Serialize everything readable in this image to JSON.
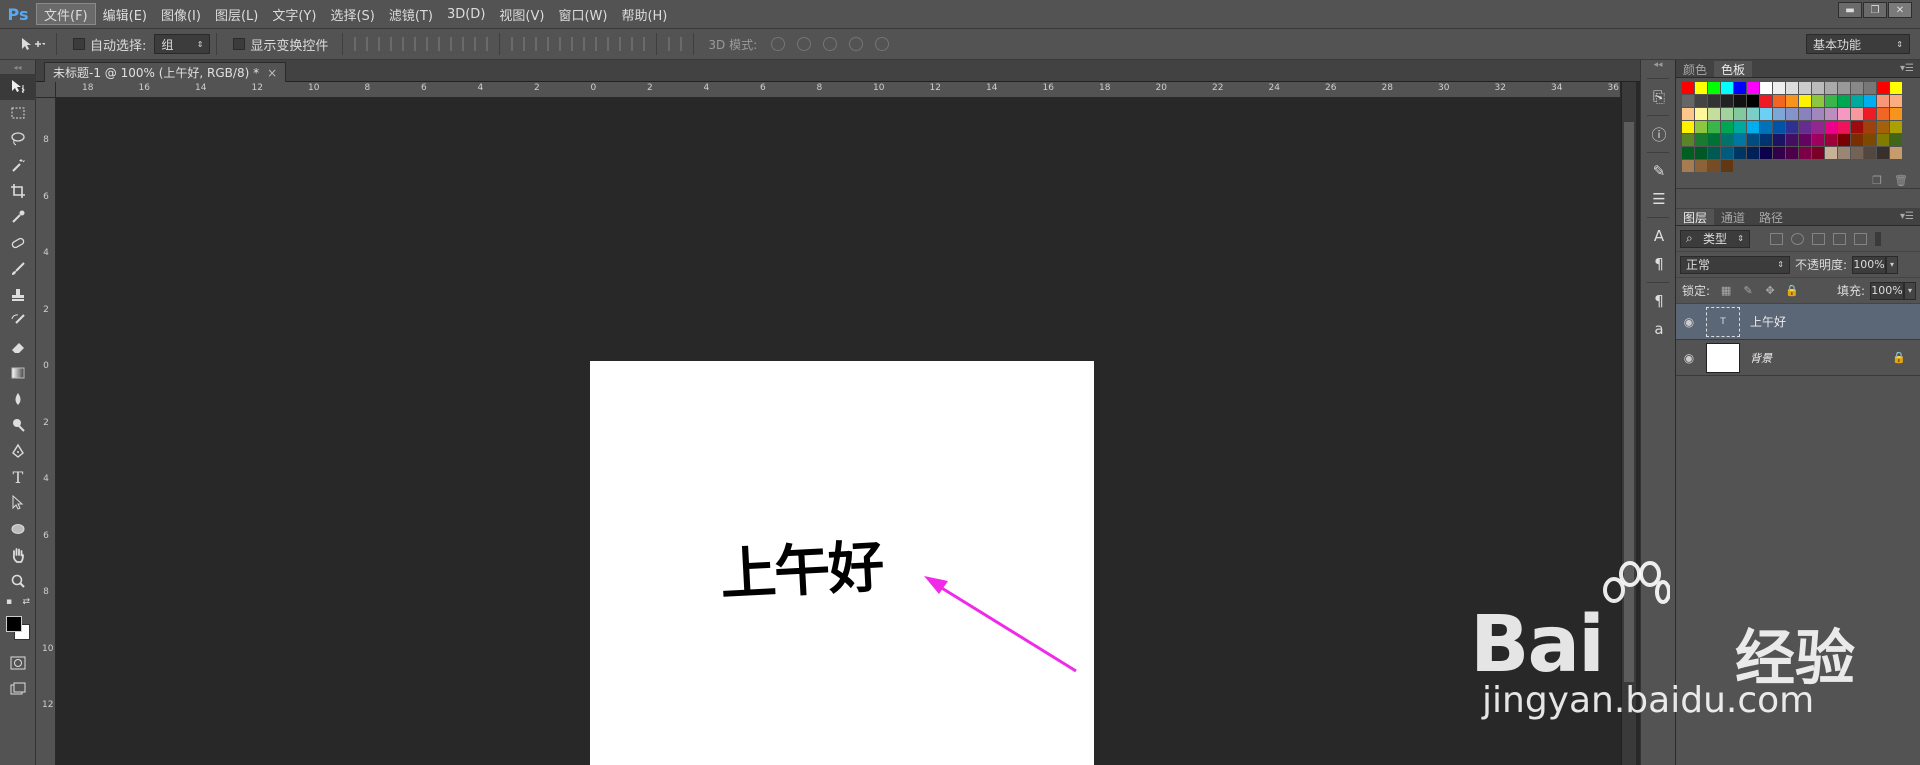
{
  "app": {
    "logo": "Ps"
  },
  "menu": [
    {
      "label": "文件(F)",
      "active": true
    },
    {
      "label": "编辑(E)"
    },
    {
      "label": "图像(I)"
    },
    {
      "label": "图层(L)"
    },
    {
      "label": "文字(Y)"
    },
    {
      "label": "选择(S)"
    },
    {
      "label": "滤镜(T)"
    },
    {
      "label": "3D(D)"
    },
    {
      "label": "视图(V)"
    },
    {
      "label": "窗口(W)"
    },
    {
      "label": "帮助(H)"
    }
  ],
  "window_buttons": {
    "minimize": "▬",
    "restore": "❐",
    "close": "✕"
  },
  "options": {
    "auto_select_label": "自动选择:",
    "auto_select_value": "组",
    "show_transform_label": "显示变换控件",
    "mode3d_label": "3D 模式:",
    "workspace": "基本功能"
  },
  "document": {
    "tab_title": "未标题-1 @ 100% (上午好, RGB/8) *",
    "close_glyph": "×",
    "text": "上午好"
  },
  "ruler_top": [
    "18",
    "16",
    "14",
    "12",
    "10",
    "8",
    "6",
    "4",
    "2",
    "0",
    "2",
    "4",
    "6",
    "8",
    "10",
    "12",
    "14",
    "16",
    "18",
    "20",
    "22",
    "24",
    "26",
    "28",
    "30",
    "32",
    "34",
    "36"
  ],
  "ruler_left": [
    "8",
    "6",
    "4",
    "2",
    "0",
    "2",
    "4",
    "6",
    "8",
    "10",
    "12"
  ],
  "panels": {
    "color_tabs": [
      {
        "label": "颜色"
      },
      {
        "label": "色板",
        "active": true
      }
    ],
    "layers_tabs": [
      {
        "label": "图层",
        "active": true
      },
      {
        "label": "通道"
      },
      {
        "label": "路径"
      }
    ],
    "filter_type": "类型",
    "blend_mode": "正常",
    "opacity_label": "不透明度:",
    "opacity_value": "100%",
    "lock_label": "锁定:",
    "fill_label": "填充:",
    "fill_value": "100%",
    "layers": [
      {
        "name": "上午好",
        "type": "text",
        "selected": true
      },
      {
        "name": "背景",
        "type": "background",
        "locked": true
      }
    ]
  },
  "swatch_colors": [
    [
      "#ff0000",
      "#ffff00",
      "#00ff00",
      "#00ffff",
      "#0000ff",
      "#ff00ff",
      "#ffffff",
      "#eeeeee",
      "#dddddd",
      "#cccccc",
      "#bbbbbb",
      "#aaaaaa",
      "#999999",
      "#888888",
      "#777777",
      "#ff0000",
      "#ffff00"
    ],
    [
      "#666666",
      "#444444",
      "#333333",
      "#222222",
      "#111111",
      "#000000",
      "#ed1c24",
      "#f26522",
      "#f7941d",
      "#fff200",
      "#8dc63f",
      "#39b54a",
      "#00a651",
      "#00a99d",
      "#00aeef",
      "#f7977a",
      "#f9ad81"
    ],
    [
      "#fdc68a",
      "#fff79a",
      "#c4df9b",
      "#a3d39c",
      "#82ca9d",
      "#7bcdc8",
      "#6ecff6",
      "#7ea7d8",
      "#8493ca",
      "#8882be",
      "#a187be",
      "#bc8dbf",
      "#f49ac2",
      "#f6989d",
      "#ed1c24",
      "#f26522",
      "#f7941d"
    ],
    [
      "#fff200",
      "#8dc63f",
      "#39b54a",
      "#00a651",
      "#00a99d",
      "#00aeef",
      "#0072bc",
      "#0054a6",
      "#2e3192",
      "#662d91",
      "#92278f",
      "#ec008c",
      "#ed145b",
      "#9e0b0f",
      "#a0410d",
      "#a3620a",
      "#aba000"
    ],
    [
      "#598527",
      "#1a7b30",
      "#007236",
      "#00746b",
      "#0076a3",
      "#004b80",
      "#003471",
      "#1b1464",
      "#440e62",
      "#630460",
      "#9e005d",
      "#9e0039",
      "#790000",
      "#7b2e00",
      "#7d4900",
      "#827b00",
      "#406618"
    ],
    [
      "#005e20",
      "#005826",
      "#005952",
      "#005b7f",
      "#003663",
      "#002157",
      "#0d004c",
      "#32004b",
      "#4b0049",
      "#7b0046",
      "#7a0026",
      "#c7b299",
      "#998675",
      "#736357",
      "#534741",
      "#37302d",
      "#c69c6d"
    ],
    [
      "#a67c52",
      "#8c6239",
      "#754c24",
      "#603913"
    ]
  ],
  "watermark": {
    "brand": "Bai",
    "brand_suffix": "经验",
    "url": "jingyan.baidu.com"
  }
}
